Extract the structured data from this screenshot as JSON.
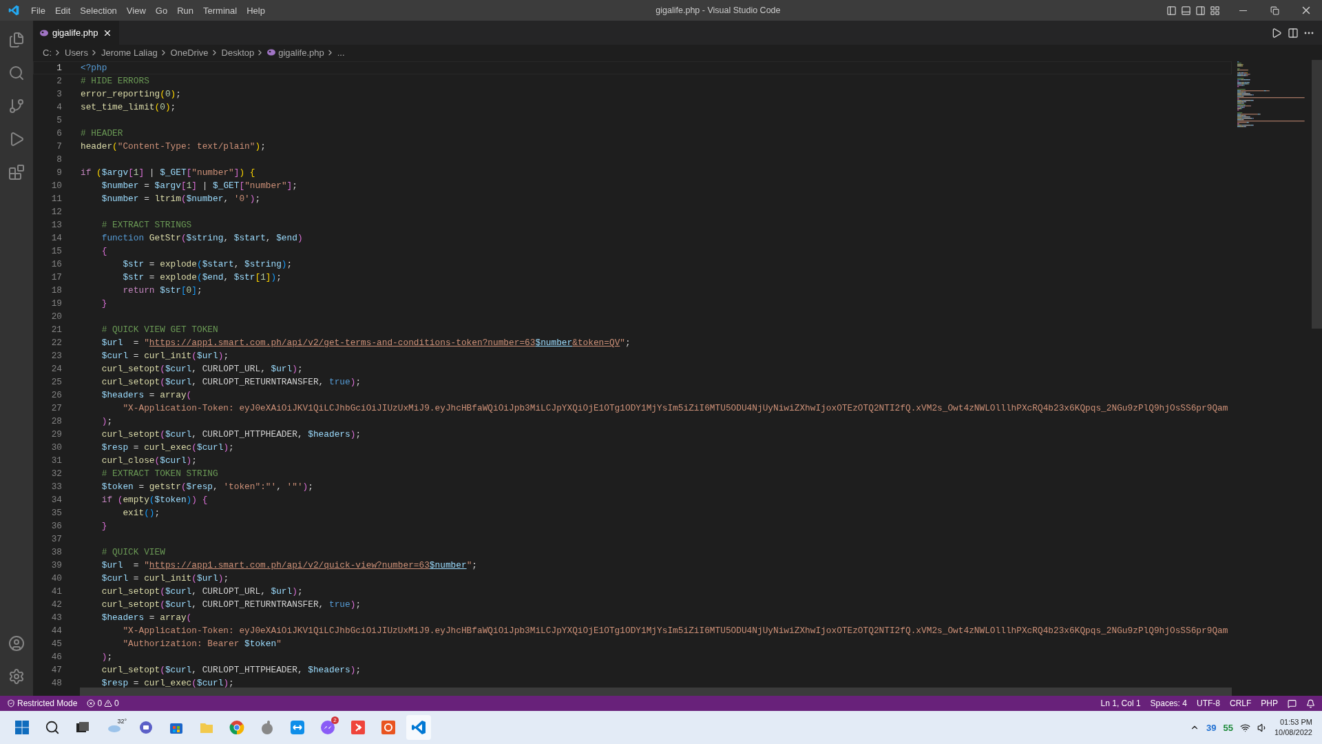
{
  "window": {
    "title": "gigalife.php - Visual Studio Code"
  },
  "menu": [
    "File",
    "Edit",
    "Selection",
    "View",
    "Go",
    "Run",
    "Terminal",
    "Help"
  ],
  "tabs": [
    {
      "label": "gigalife.php",
      "selected": true
    }
  ],
  "breadcrumb": [
    "C:",
    "Users",
    "Jerome Laliag",
    "OneDrive",
    "Desktop",
    "gigalife.php",
    "..."
  ],
  "editor": {
    "lines": [
      {
        "number": "1",
        "current": true,
        "tokens": [
          {
            "kind": "tag",
            "text": "<?php"
          }
        ]
      },
      {
        "number": "2",
        "current": false,
        "tokens": [
          {
            "kind": "comment",
            "text": "# HIDE ERRORS"
          }
        ]
      },
      {
        "number": "3",
        "current": false,
        "tokens": [
          {
            "kind": "function",
            "text": "error_reporting"
          },
          {
            "kind": "bracket1",
            "text": "("
          },
          {
            "kind": "number",
            "text": "0"
          },
          {
            "kind": "bracket1",
            "text": ")"
          },
          {
            "kind": "plain",
            "text": ";"
          }
        ]
      },
      {
        "number": "4",
        "current": false,
        "tokens": [
          {
            "kind": "function",
            "text": "set_time_limit"
          },
          {
            "kind": "bracket1",
            "text": "("
          },
          {
            "kind": "number",
            "text": "0"
          },
          {
            "kind": "bracket1",
            "text": ")"
          },
          {
            "kind": "plain",
            "text": ";"
          }
        ]
      },
      {
        "number": "5",
        "current": false
      },
      {
        "number": "6",
        "current": false,
        "tokens": [
          {
            "kind": "comment",
            "text": "# HEADER"
          }
        ]
      },
      {
        "number": "7",
        "current": false,
        "tokens": [
          {
            "kind": "function",
            "text": "header"
          },
          {
            "kind": "bracket1",
            "text": "("
          },
          {
            "kind": "string",
            "text": "\"Content-Type: text/plain\""
          },
          {
            "kind": "bracket1",
            "text": ")"
          },
          {
            "kind": "plain",
            "text": ";"
          }
        ]
      },
      {
        "number": "8",
        "current": false
      },
      {
        "number": "9",
        "current": false,
        "tokens": [
          {
            "kind": "control",
            "text": "if"
          },
          {
            "kind": "bracket1",
            "text": " ("
          },
          {
            "kind": "variable",
            "text": "$argv"
          },
          {
            "kind": "bracket2",
            "text": "["
          },
          {
            "kind": "number",
            "text": "1"
          },
          {
            "kind": "bracket2",
            "text": "]"
          },
          {
            "kind": "plain",
            "text": " | "
          },
          {
            "kind": "variable",
            "text": "$_GET"
          },
          {
            "kind": "bracket2",
            "text": "["
          },
          {
            "kind": "string",
            "text": "\"number\""
          },
          {
            "kind": "bracket2",
            "text": "]"
          },
          {
            "kind": "bracket1",
            "text": ")"
          },
          {
            "kind": "bracket1",
            "text": " {"
          }
        ]
      },
      {
        "number": "10",
        "current": false,
        "tokens": [
          {
            "kind": "variable",
            "text": "    $number"
          },
          {
            "kind": "plain",
            "text": " = "
          },
          {
            "kind": "variable",
            "text": "$argv"
          },
          {
            "kind": "bracket2",
            "text": "["
          },
          {
            "kind": "number",
            "text": "1"
          },
          {
            "kind": "bracket2",
            "text": "]"
          },
          {
            "kind": "plain",
            "text": " | "
          },
          {
            "kind": "variable",
            "text": "$_GET"
          },
          {
            "kind": "bracket2",
            "text": "["
          },
          {
            "kind": "string",
            "text": "\"number\""
          },
          {
            "kind": "bracket2",
            "text": "]"
          },
          {
            "kind": "plain",
            "text": ";"
          }
        ]
      },
      {
        "number": "11",
        "current": false,
        "tokens": [
          {
            "kind": "variable",
            "text": "    $number"
          },
          {
            "kind": "plain",
            "text": " = "
          },
          {
            "kind": "function",
            "text": "ltrim"
          },
          {
            "kind": "bracket2",
            "text": "("
          },
          {
            "kind": "variable",
            "text": "$number"
          },
          {
            "kind": "plain",
            "text": ","
          },
          {
            "kind": "string",
            "text": " '0'"
          },
          {
            "kind": "bracket2",
            "text": ")"
          },
          {
            "kind": "plain",
            "text": ";"
          }
        ]
      },
      {
        "number": "12",
        "current": false
      },
      {
        "number": "13",
        "current": false,
        "tokens": [
          {
            "kind": "comment",
            "text": "    # EXTRACT STRINGS"
          }
        ]
      },
      {
        "number": "14",
        "current": false,
        "tokens": [
          {
            "kind": "keyword",
            "text": "    function"
          },
          {
            "kind": "function",
            "text": " GetStr"
          },
          {
            "kind": "bracket2",
            "text": "("
          },
          {
            "kind": "variable",
            "text": "$string"
          },
          {
            "kind": "plain",
            "text": ","
          },
          {
            "kind": "variable",
            "text": " $start"
          },
          {
            "kind": "plain",
            "text": ","
          },
          {
            "kind": "variable",
            "text": " $end"
          },
          {
            "kind": "bracket2",
            "text": ")"
          }
        ]
      },
      {
        "number": "15",
        "current": false,
        "tokens": [
          {
            "kind": "bracket2",
            "text": "    {"
          }
        ]
      },
      {
        "number": "16",
        "current": false,
        "tokens": [
          {
            "kind": "variable",
            "text": "        $str"
          },
          {
            "kind": "plain",
            "text": " = "
          },
          {
            "kind": "function",
            "text": "explode"
          },
          {
            "kind": "bracket3",
            "text": "("
          },
          {
            "kind": "variable",
            "text": "$start"
          },
          {
            "kind": "plain",
            "text": ","
          },
          {
            "kind": "variable",
            "text": " $string"
          },
          {
            "kind": "bracket3",
            "text": ")"
          },
          {
            "kind": "plain",
            "text": ";"
          }
        ]
      },
      {
        "number": "17",
        "current": false,
        "tokens": [
          {
            "kind": "variable",
            "text": "        $str"
          },
          {
            "kind": "plain",
            "text": " = "
          },
          {
            "kind": "function",
            "text": "explode"
          },
          {
            "kind": "bracket3",
            "text": "("
          },
          {
            "kind": "variable",
            "text": "$end"
          },
          {
            "kind": "plain",
            "text": ","
          },
          {
            "kind": "variable",
            "text": " $str"
          },
          {
            "kind": "bracket1",
            "text": "["
          },
          {
            "kind": "number",
            "text": "1"
          },
          {
            "kind": "bracket1",
            "text": "]"
          },
          {
            "kind": "bracket3",
            "text": ")"
          },
          {
            "kind": "plain",
            "text": ";"
          }
        ]
      },
      {
        "number": "18",
        "current": false,
        "tokens": [
          {
            "kind": "control",
            "text": "        return"
          },
          {
            "kind": "variable",
            "text": " $str"
          },
          {
            "kind": "bracket3",
            "text": "["
          },
          {
            "kind": "number",
            "text": "0"
          },
          {
            "kind": "bracket3",
            "text": "]"
          },
          {
            "kind": "plain",
            "text": ";"
          }
        ]
      },
      {
        "number": "19",
        "current": false,
        "tokens": [
          {
            "kind": "bracket2",
            "text": "    }"
          }
        ]
      },
      {
        "number": "20",
        "current": false
      },
      {
        "number": "21",
        "current": false,
        "tokens": [
          {
            "kind": "comment",
            "text": "    # QUICK VIEW GET TOKEN"
          }
        ]
      },
      {
        "number": "22",
        "current": false,
        "tokens": [
          {
            "kind": "variable",
            "text": "    $url"
          },
          {
            "kind": "plain",
            "text": "  = "
          },
          {
            "kind": "string",
            "text": "\""
          },
          {
            "kind": "link",
            "text": "https://app1.smart.com.ph/api/v2/get-terms-and-conditions-token?number=63"
          },
          {
            "kind": "link_variable",
            "text": "$number"
          },
          {
            "kind": "link",
            "text": "&token=QV"
          },
          {
            "kind": "string",
            "text": "\""
          },
          {
            "kind": "plain",
            "text": ";"
          }
        ]
      },
      {
        "number": "23",
        "current": false,
        "tokens": [
          {
            "kind": "variable",
            "text": "    $curl"
          },
          {
            "kind": "plain",
            "text": " = "
          },
          {
            "kind": "function",
            "text": "curl_init"
          },
          {
            "kind": "bracket2",
            "text": "("
          },
          {
            "kind": "variable",
            "text": "$url"
          },
          {
            "kind": "bracket2",
            "text": ")"
          },
          {
            "kind": "plain",
            "text": ";"
          }
        ]
      },
      {
        "number": "24",
        "current": false,
        "tokens": [
          {
            "kind": "function",
            "text": "    curl_setopt"
          },
          {
            "kind": "bracket2",
            "text": "("
          },
          {
            "kind": "variable",
            "text": "$curl"
          },
          {
            "kind": "plain",
            "text": ", CURLOPT_URL, "
          },
          {
            "kind": "variable",
            "text": "$url"
          },
          {
            "kind": "bracket2",
            "text": ")"
          },
          {
            "kind": "plain",
            "text": ";"
          }
        ]
      },
      {
        "number": "25",
        "current": false,
        "tokens": [
          {
            "kind": "function",
            "text": "    curl_setopt"
          },
          {
            "kind": "bracket2",
            "text": "("
          },
          {
            "kind": "variable",
            "text": "$curl"
          },
          {
            "kind": "plain",
            "text": ", CURLOPT_RETURNTRANSFER, "
          },
          {
            "kind": "keyword",
            "text": "true"
          },
          {
            "kind": "bracket2",
            "text": ")"
          },
          {
            "kind": "plain",
            "text": ";"
          }
        ]
      },
      {
        "number": "26",
        "current": false,
        "tokens": [
          {
            "kind": "variable",
            "text": "    $headers"
          },
          {
            "kind": "plain",
            "text": " = "
          },
          {
            "kind": "function",
            "text": "array"
          },
          {
            "kind": "bracket2",
            "text": "("
          }
        ]
      },
      {
        "number": "27",
        "current": false,
        "tokens": [
          {
            "kind": "string",
            "text": "        \"X-Application-Token: eyJ0eXAiOiJKV1QiLCJhbGciOiJIUzUxMiJ9.eyJhcHBfaWQiOiJpb3MiLCJpYXQiOjE1OTg1ODY1MjYsIm5iZiI6MTU5ODU4NjUyNiwiZXhwIjoxOTEzOTQ2NTI2fQ.xVM2s_Owt4zNWLOlllhPXcRQ4b23x6KQpqs_2NGu9zPlQ9hjOsSS6pr9Qam"
          }
        ]
      },
      {
        "number": "28",
        "current": false,
        "tokens": [
          {
            "kind": "bracket2",
            "text": "    )"
          },
          {
            "kind": "plain",
            "text": ";"
          }
        ]
      },
      {
        "number": "29",
        "current": false,
        "tokens": [
          {
            "kind": "function",
            "text": "    curl_setopt"
          },
          {
            "kind": "bracket2",
            "text": "("
          },
          {
            "kind": "variable",
            "text": "$curl"
          },
          {
            "kind": "plain",
            "text": ", CURLOPT_HTTPHEADER, "
          },
          {
            "kind": "variable",
            "text": "$headers"
          },
          {
            "kind": "bracket2",
            "text": ")"
          },
          {
            "kind": "plain",
            "text": ";"
          }
        ]
      },
      {
        "number": "30",
        "current": false,
        "tokens": [
          {
            "kind": "variable",
            "text": "    $resp"
          },
          {
            "kind": "plain",
            "text": " = "
          },
          {
            "kind": "function",
            "text": "curl_exec"
          },
          {
            "kind": "bracket2",
            "text": "("
          },
          {
            "kind": "variable",
            "text": "$curl"
          },
          {
            "kind": "bracket2",
            "text": ")"
          },
          {
            "kind": "plain",
            "text": ";"
          }
        ]
      },
      {
        "number": "31",
        "current": false,
        "tokens": [
          {
            "kind": "function",
            "text": "    curl_close"
          },
          {
            "kind": "bracket2",
            "text": "("
          },
          {
            "kind": "variable",
            "text": "$curl"
          },
          {
            "kind": "bracket2",
            "text": ")"
          },
          {
            "kind": "plain",
            "text": ";"
          }
        ]
      },
      {
        "number": "32",
        "current": false,
        "tokens": [
          {
            "kind": "comment",
            "text": "    # EXTRACT TOKEN STRING"
          }
        ]
      },
      {
        "number": "33",
        "current": false,
        "tokens": [
          {
            "kind": "variable",
            "text": "    $token"
          },
          {
            "kind": "plain",
            "text": " = "
          },
          {
            "kind": "function",
            "text": "getstr"
          },
          {
            "kind": "bracket2",
            "text": "("
          },
          {
            "kind": "variable",
            "text": "$resp"
          },
          {
            "kind": "plain",
            "text": ","
          },
          {
            "kind": "string",
            "text": " 'token\":\"'"
          },
          {
            "kind": "plain",
            "text": ","
          },
          {
            "kind": "string",
            "text": " '\"'"
          },
          {
            "kind": "bracket2",
            "text": ")"
          },
          {
            "kind": "plain",
            "text": ";"
          }
        ]
      },
      {
        "number": "34",
        "current": false,
        "tokens": [
          {
            "kind": "control",
            "text": "    if"
          },
          {
            "kind": "bracket2",
            "text": " ("
          },
          {
            "kind": "function",
            "text": "empty"
          },
          {
            "kind": "bracket3",
            "text": "("
          },
          {
            "kind": "variable",
            "text": "$token"
          },
          {
            "kind": "bracket3",
            "text": ")"
          },
          {
            "kind": "bracket2",
            "text": ")"
          },
          {
            "kind": "bracket2",
            "text": " {"
          }
        ]
      },
      {
        "number": "35",
        "current": false,
        "tokens": [
          {
            "kind": "function",
            "text": "        exit"
          },
          {
            "kind": "bracket3",
            "text": "()"
          },
          {
            "kind": "plain",
            "text": ";"
          }
        ]
      },
      {
        "number": "36",
        "current": false,
        "tokens": [
          {
            "kind": "bracket2",
            "text": "    }"
          }
        ]
      },
      {
        "number": "37",
        "current": false
      },
      {
        "number": "38",
        "current": false,
        "tokens": [
          {
            "kind": "comment",
            "text": "    # QUICK VIEW"
          }
        ]
      },
      {
        "number": "39",
        "current": false,
        "tokens": [
          {
            "kind": "variable",
            "text": "    $url"
          },
          {
            "kind": "plain",
            "text": "  = "
          },
          {
            "kind": "string",
            "text": "\""
          },
          {
            "kind": "link",
            "text": "https://app1.smart.com.ph/api/v2/quick-view?number=63"
          },
          {
            "kind": "link_variable",
            "text": "$number"
          },
          {
            "kind": "string",
            "text": "\""
          },
          {
            "kind": "plain",
            "text": ";"
          }
        ]
      },
      {
        "number": "40",
        "current": false,
        "tokens": [
          {
            "kind": "variable",
            "text": "    $curl"
          },
          {
            "kind": "plain",
            "text": " = "
          },
          {
            "kind": "function",
            "text": "curl_init"
          },
          {
            "kind": "bracket2",
            "text": "("
          },
          {
            "kind": "variable",
            "text": "$url"
          },
          {
            "kind": "bracket2",
            "text": ")"
          },
          {
            "kind": "plain",
            "text": ";"
          }
        ]
      },
      {
        "number": "41",
        "current": false,
        "tokens": [
          {
            "kind": "function",
            "text": "    curl_setopt"
          },
          {
            "kind": "bracket2",
            "text": "("
          },
          {
            "kind": "variable",
            "text": "$curl"
          },
          {
            "kind": "plain",
            "text": ", CURLOPT_URL, "
          },
          {
            "kind": "variable",
            "text": "$url"
          },
          {
            "kind": "bracket2",
            "text": ")"
          },
          {
            "kind": "plain",
            "text": ";"
          }
        ]
      },
      {
        "number": "42",
        "current": false,
        "tokens": [
          {
            "kind": "function",
            "text": "    curl_setopt"
          },
          {
            "kind": "bracket2",
            "text": "("
          },
          {
            "kind": "variable",
            "text": "$curl"
          },
          {
            "kind": "plain",
            "text": ", CURLOPT_RETURNTRANSFER, "
          },
          {
            "kind": "keyword",
            "text": "true"
          },
          {
            "kind": "bracket2",
            "text": ")"
          },
          {
            "kind": "plain",
            "text": ";"
          }
        ]
      },
      {
        "number": "43",
        "current": false,
        "tokens": [
          {
            "kind": "variable",
            "text": "    $headers"
          },
          {
            "kind": "plain",
            "text": " = "
          },
          {
            "kind": "function",
            "text": "array"
          },
          {
            "kind": "bracket2",
            "text": "("
          }
        ]
      },
      {
        "number": "44",
        "current": false,
        "tokens": [
          {
            "kind": "string",
            "text": "        \"X-Application-Token: eyJ0eXAiOiJKV1QiLCJhbGciOiJIUzUxMiJ9.eyJhcHBfaWQiOiJpb3MiLCJpYXQiOjE1OTg1ODY1MjYsIm5iZiI6MTU5ODU4NjUyNiwiZXhwIjoxOTEzOTQ2NTI2fQ.xVM2s_Owt4zNWLOlllhPXcRQ4b23x6KQpqs_2NGu9zPlQ9hjOsSS6pr9Qam"
          }
        ]
      },
      {
        "number": "45",
        "current": false,
        "tokens": [
          {
            "kind": "string",
            "text": "        \"Authorization: Bearer"
          },
          {
            "kind": "variable",
            "text": " $token"
          },
          {
            "kind": "string",
            "text": "\""
          }
        ]
      },
      {
        "number": "46",
        "current": false,
        "tokens": [
          {
            "kind": "bracket2",
            "text": "    )"
          },
          {
            "kind": "plain",
            "text": ";"
          }
        ]
      },
      {
        "number": "47",
        "current": false,
        "tokens": [
          {
            "kind": "function",
            "text": "    curl_setopt"
          },
          {
            "kind": "bracket2",
            "text": "("
          },
          {
            "kind": "variable",
            "text": "$curl"
          },
          {
            "kind": "plain",
            "text": ", CURLOPT_HTTPHEADER, "
          },
          {
            "kind": "variable",
            "text": "$headers"
          },
          {
            "kind": "bracket2",
            "text": ")"
          },
          {
            "kind": "plain",
            "text": ";"
          }
        ]
      },
      {
        "number": "48",
        "current": false,
        "tokens": [
          {
            "kind": "variable",
            "text": "    $resp"
          },
          {
            "kind": "plain",
            "text": " = "
          },
          {
            "kind": "function",
            "text": "curl_exec"
          },
          {
            "kind": "bracket2",
            "text": "("
          },
          {
            "kind": "variable",
            "text": "$curl"
          },
          {
            "kind": "bracket2",
            "text": ")"
          },
          {
            "kind": "plain",
            "text": ";"
          }
        ]
      }
    ]
  },
  "status_bar": {
    "mode": "Restricted Mode",
    "errors": "0",
    "warnings": "0",
    "items": [
      "Ln 1, Col 1",
      "Spaces: 4",
      "UTF-8",
      "CRLF",
      "PHP"
    ]
  },
  "taskbar": {
    "weather": "32°",
    "messenger_badge": "2",
    "tray": [
      {
        "text": "39",
        "color": "#1f6fd1"
      },
      {
        "text": "55",
        "color": "#1e8a3a"
      }
    ],
    "time": "01:53 PM",
    "date": "10/08/2022"
  }
}
